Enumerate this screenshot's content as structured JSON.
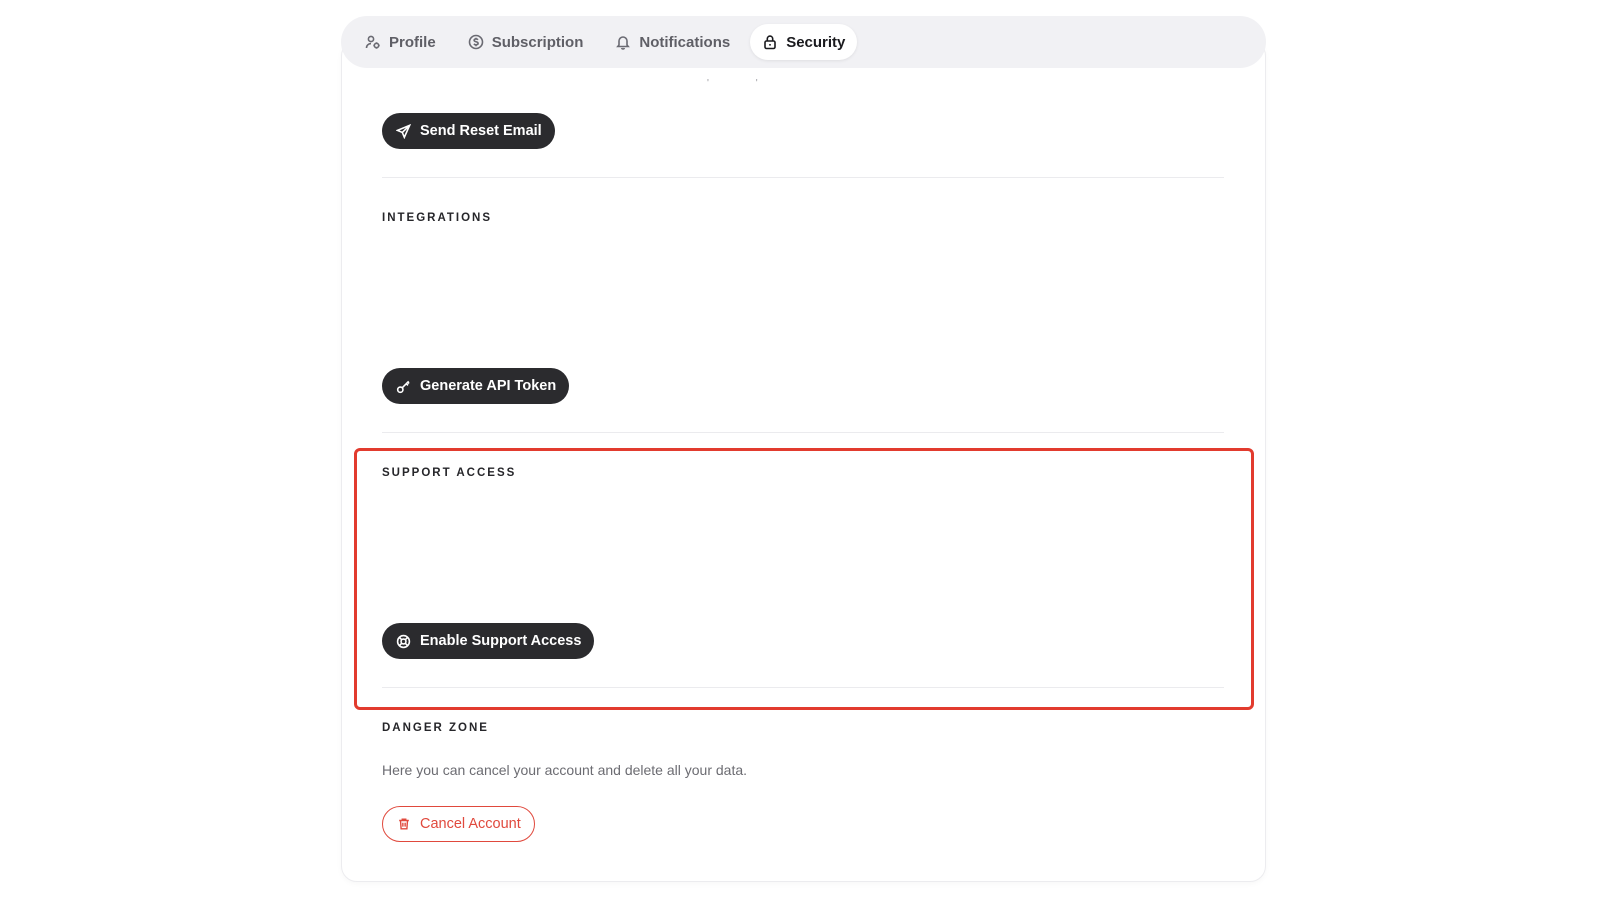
{
  "tabs": [
    {
      "label": "Profile",
      "icon": "user-settings-icon"
    },
    {
      "label": "Subscription",
      "icon": "dollar-circle-icon"
    },
    {
      "label": "Notifications",
      "icon": "bell-icon"
    },
    {
      "label": "Security",
      "icon": "lock-icon",
      "active": true
    }
  ],
  "password": {
    "send_reset_label": "Send Reset Email"
  },
  "integrations": {
    "title": "INTEGRATIONS",
    "generate_token_label": "Generate API Token"
  },
  "support_access": {
    "title": "SUPPORT ACCESS",
    "enable_label": "Enable Support Access",
    "highlight_color": "#e23b2e"
  },
  "danger_zone": {
    "title": "DANGER ZONE",
    "description": "Here you can cancel your account and delete all your data.",
    "cancel_label": "Cancel Account",
    "accent_color": "#e0493d"
  }
}
